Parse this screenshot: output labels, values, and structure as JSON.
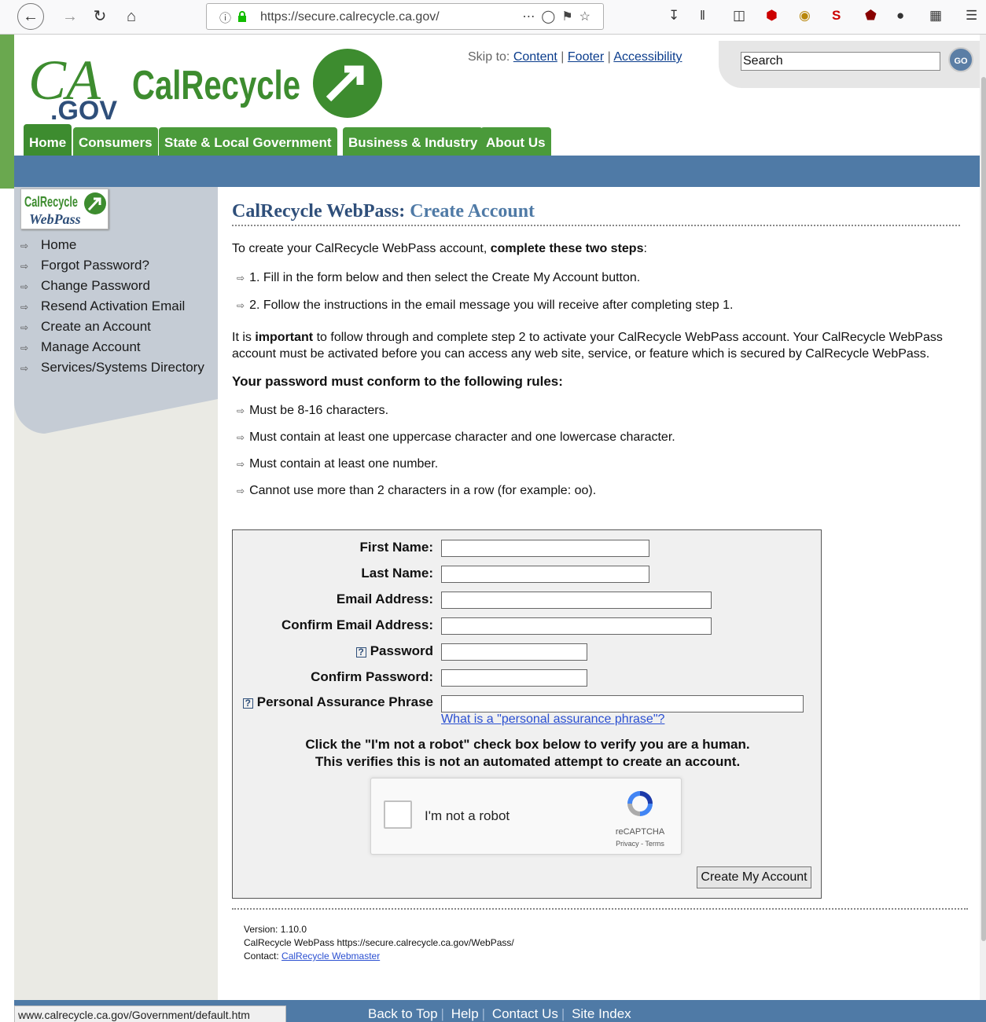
{
  "browser": {
    "url": "https://secure.calrecycle.ca.gov/",
    "info_icon": "info-icon",
    "lock_icon": "lock-icon"
  },
  "header": {
    "ca_gov_logo_text": "CA.GOV",
    "calrecycle_logo_text": "CalRecycle",
    "skip_to_label": "Skip to:",
    "skip_links": [
      "Content",
      "Footer",
      "Accessibility"
    ],
    "search_value": "Search",
    "go_label": "GO",
    "tabs": [
      "Home",
      "Consumers",
      "State & Local Government",
      "Business & Industry",
      "About Us"
    ]
  },
  "sidebar": {
    "logo_line1": "CalRecycle",
    "logo_line2": "WebPass",
    "items": [
      "Home",
      "Forgot Password?",
      "Change Password",
      "Resend Activation Email",
      "Create an Account",
      "Manage Account",
      "Services/Systems Directory"
    ]
  },
  "main": {
    "title_prefix": "CalRecycle WebPass:",
    "title_accent": "Create Account",
    "intro_plain": "To create your CalRecycle WebPass account,",
    "intro_bold": "complete these two steps",
    "intro_end": ":",
    "steps": [
      "1. Fill in the form below and then select the Create My Account button.",
      "2. Follow the instructions in the email message you will receive after completing step 1."
    ],
    "important_pre": "It is",
    "important_bold": "important",
    "important_post": "to follow through and complete step 2 to activate your CalRecycle WebPass account. Your CalRecycle WebPass account must be activated before you can access any web site, service, or feature which is secured by CalRecycle WebPass.",
    "rules_heading": "Your password must conform to the following rules:",
    "rules": [
      "Must be 8-16 characters.",
      "Must contain at least one uppercase character and one lowercase character.",
      "Must contain at least one number.",
      "Cannot use more than 2 characters in a row (for example: oo)."
    ]
  },
  "form": {
    "first_name_label": "First Name:",
    "first_name_value": "",
    "last_name_label": "Last Name:",
    "last_name_value": "",
    "email_label": "Email Address:",
    "email_value": "",
    "confirm_email_label": "Confirm Email Address:",
    "confirm_email_value": "",
    "password_label": "Password",
    "confirm_password_label": "Confirm Password:",
    "pap_label": "Personal Assurance Phrase",
    "pap_value": "",
    "pap_link": "What is a \"personal assurance phrase\"?",
    "captcha_line1": "Click the \"I'm not a robot\" check box below to verify you are a human.",
    "captcha_line2": "This verifies this is not an automated attempt to create an account.",
    "recaptcha_label": "I'm not a robot",
    "recaptcha_brand": "reCAPTCHA",
    "recaptcha_terms": "Privacy - Terms",
    "create_button": "Create My Account",
    "help_glyph": "?"
  },
  "footer": {
    "version": "Version: 1.10.0",
    "webpass_line": "CalRecycle WebPass https://secure.calrecycle.ca.gov/WebPass/",
    "contact_label": "Contact:",
    "contact_link": "CalRecycle Webmaster",
    "bottom_links": [
      "Back to Top",
      "Help",
      "Contact Us",
      "Site Index"
    ],
    "status_url": "www.calrecycle.ca.gov/Government/default.htm"
  },
  "colors": {
    "brand_green": "#4a9a3a",
    "brand_blue": "#4f7aa6",
    "title_blue": "#2f4f7a",
    "link_blue": "#2a4fd1"
  }
}
